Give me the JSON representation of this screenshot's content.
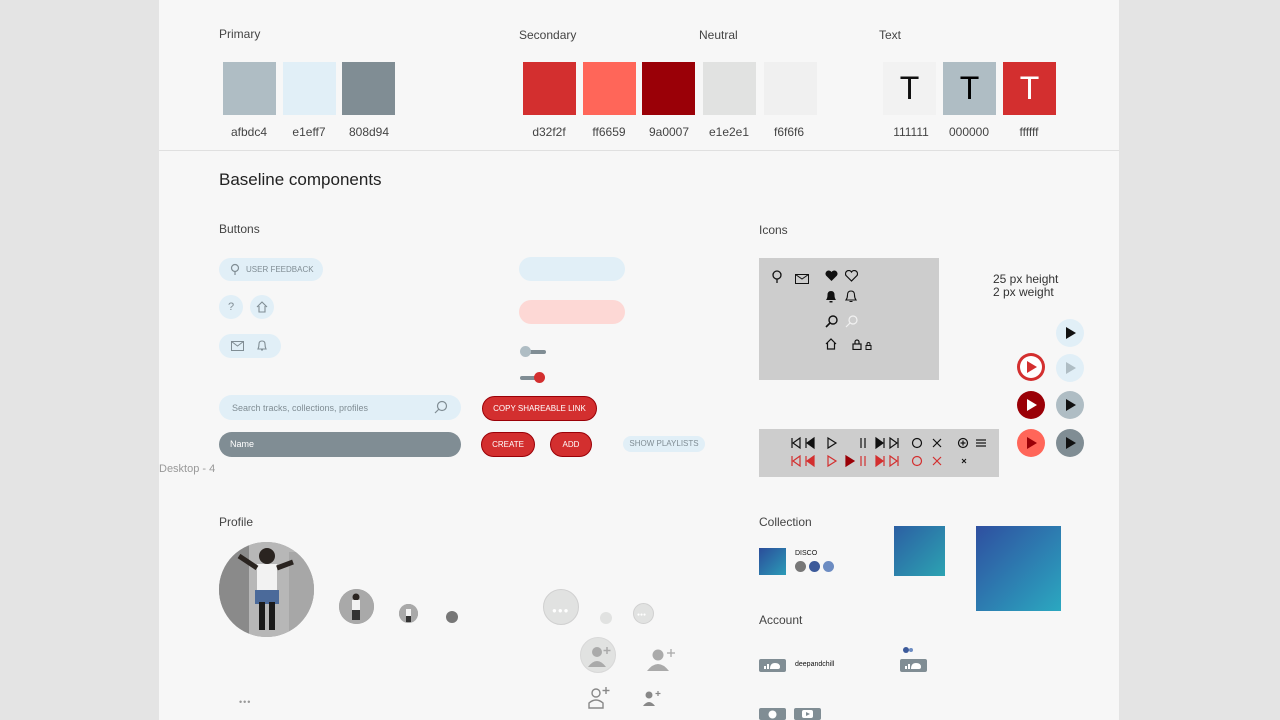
{
  "frame_label": "Desktop - 4",
  "sections": {
    "primary": "Primary",
    "secondary": "Secondary",
    "neutral": "Neutral",
    "text": "Text",
    "baseline": "Baseline components",
    "buttons": "Buttons",
    "icons": "Icons",
    "profile": "Profile",
    "collection": "Collection",
    "account": "Account"
  },
  "palette": {
    "primary": [
      {
        "hex": "#afbdc4",
        "label": "afbdc4"
      },
      {
        "hex": "#e1eff7",
        "label": "e1eff7"
      },
      {
        "hex": "#808d94",
        "label": "808d94"
      }
    ],
    "secondary": [
      {
        "hex": "#d32f2f",
        "label": "d32f2f"
      },
      {
        "hex": "#ff6659",
        "label": "ff6659"
      },
      {
        "hex": "#9a0007",
        "label": "9a0007"
      }
    ],
    "neutral": [
      {
        "hex": "#e1e2e1",
        "label": "e1e2e1"
      },
      {
        "hex": "#f6f6f6",
        "label": "f6f6f6"
      }
    ],
    "text": [
      {
        "glyph": "T",
        "label": "111111"
      },
      {
        "glyph": "T",
        "label": "000000"
      },
      {
        "glyph": "T",
        "label": "ffffff"
      }
    ]
  },
  "buttons": {
    "user_feedback": "USER FEEDBACK",
    "search_placeholder": "Search tracks, collections, profiles",
    "name_placeholder": "Name",
    "copy_link": "COPY SHAREABLE LINK",
    "create": "CREATE",
    "add": "ADD",
    "show_playlists": "SHOW PLAYLISTS"
  },
  "icons": {
    "spec_line1": "25 px height",
    "spec_line2": "2 px weight"
  },
  "collection": {
    "item_title": "DISCO"
  },
  "account": {
    "username": "deepandchill"
  },
  "profile": {
    "more": "•••"
  }
}
